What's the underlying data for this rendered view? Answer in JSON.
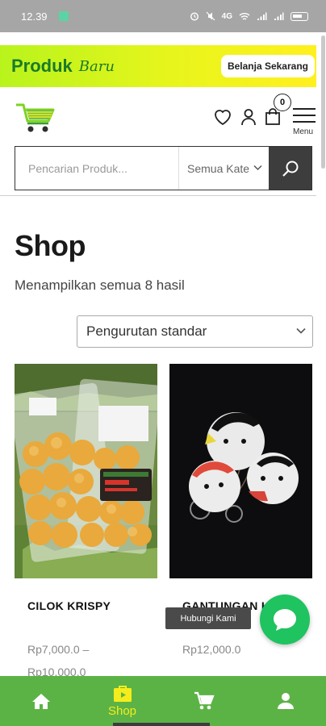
{
  "status_bar": {
    "time": "12.39",
    "network": "4G",
    "icons": [
      "alarm-icon",
      "mute-icon",
      "wifi-icon",
      "signal-icon",
      "signal-icon",
      "battery-icon"
    ]
  },
  "promo": {
    "title_bold": "Produk",
    "title_script": "Baru",
    "button_label": "Belanja Sekarang"
  },
  "header": {
    "logo_icon": "cart-logo-icon",
    "cart_count": "0",
    "menu_label": "Menu"
  },
  "search": {
    "placeholder": "Pencarian Produk...",
    "category_value": "Semua Kate"
  },
  "shop": {
    "title": "Shop",
    "result_count": "Menampilkan semua 8 hasil",
    "sort_value": "Pengurutan standar"
  },
  "products": [
    {
      "name": "CILOK KRISPY",
      "price_line1": "Rp7,000.0 –",
      "price_line2": "Rp10,000.0"
    },
    {
      "name": "GANTUNGAN K",
      "price_line1": "Rp12,000.0",
      "price_line2": ""
    }
  ],
  "contact": {
    "tooltip": "Hubungi Kami"
  },
  "bottom_nav": {
    "items": [
      {
        "icon": "home-icon",
        "label": ""
      },
      {
        "icon": "shop-bag-icon",
        "label": "Shop"
      },
      {
        "icon": "cart-icon",
        "label": ""
      },
      {
        "icon": "account-icon",
        "label": ""
      }
    ]
  },
  "colors": {
    "nav_green": "#5cb345",
    "nav_active": "#f5ec1c",
    "fab_green": "#1fc35f",
    "promo_text": "#1a7a2b"
  }
}
